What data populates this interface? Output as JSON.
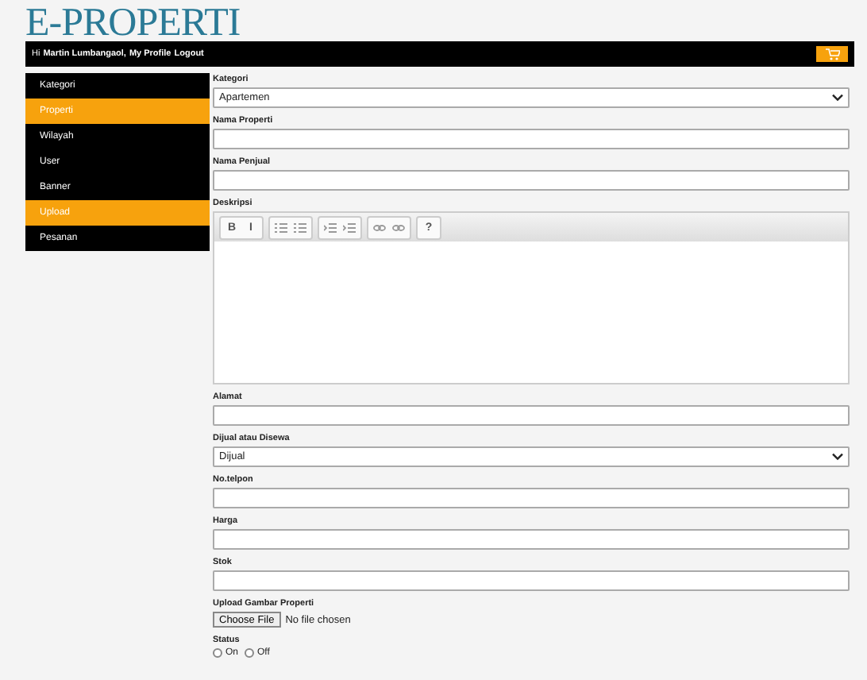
{
  "logo": "E-PROPERTI",
  "topbar": {
    "greeting": "Hi",
    "user": "Martin Lumbangaol,",
    "profile_link": "My Profile",
    "logout_link": "Logout"
  },
  "sidebar": {
    "items": [
      {
        "label": "Kategori",
        "selected": false
      },
      {
        "label": "Properti",
        "selected": true
      },
      {
        "label": "Wilayah",
        "selected": false
      },
      {
        "label": "User",
        "selected": false
      },
      {
        "label": "Banner",
        "selected": false
      },
      {
        "label": "Upload",
        "selected": true
      },
      {
        "label": "Pesanan",
        "selected": false
      }
    ]
  },
  "form": {
    "fields": [
      {
        "kind": "select",
        "label": "Kategori",
        "value": "Apartemen"
      },
      {
        "kind": "text",
        "label": "Nama Properti"
      },
      {
        "kind": "text",
        "label": "Nama Penjual"
      },
      {
        "kind": "editor",
        "label": "Deskripsi",
        "toolbar": [
          [
            {
              "kind": "text",
              "label": "B"
            },
            {
              "kind": "text",
              "label": "I"
            }
          ],
          [
            {
              "kind": "ordered-list"
            },
            {
              "kind": "unordered-list"
            }
          ],
          [
            {
              "kind": "outdent"
            },
            {
              "kind": "indent"
            }
          ],
          [
            {
              "kind": "link"
            },
            {
              "kind": "unlink"
            }
          ],
          [
            {
              "kind": "text",
              "label": "?"
            }
          ]
        ]
      },
      {
        "kind": "text",
        "label": "Alamat"
      },
      {
        "kind": "select",
        "label": "Dijual atau Disewa",
        "value": "Dijual"
      },
      {
        "kind": "text",
        "label": "No.telpon"
      },
      {
        "kind": "text",
        "label": "Harga"
      },
      {
        "kind": "text",
        "label": "Stok"
      },
      {
        "kind": "file",
        "label": "Upload Gambar Properti",
        "button": "Choose File",
        "status": "No file chosen"
      },
      {
        "kind": "radio",
        "label": "Status",
        "options": [
          {
            "label": "On",
            "selected": false
          },
          {
            "label": "Off",
            "selected": false
          }
        ]
      }
    ]
  }
}
